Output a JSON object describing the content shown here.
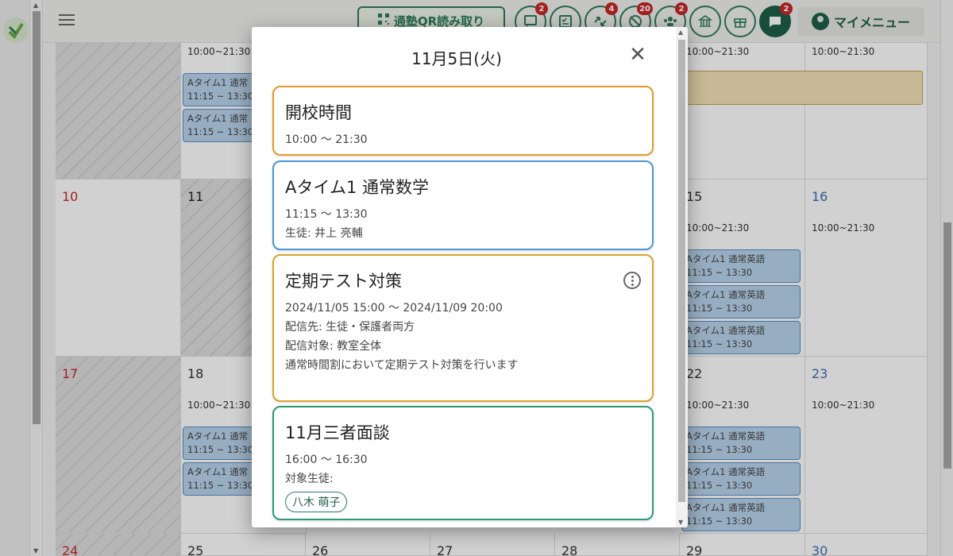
{
  "header": {
    "qr_button_label": "通塾QR読み取り",
    "icons": [
      {
        "name": "message-icon",
        "badge": "2"
      },
      {
        "name": "checklist-icon",
        "badge": ""
      },
      {
        "name": "exchange-icon",
        "badge": "4"
      },
      {
        "name": "blocked-icon",
        "badge": "20"
      },
      {
        "name": "group-icon",
        "badge": "2"
      },
      {
        "name": "school-icon",
        "badge": ""
      },
      {
        "name": "gift-icon",
        "badge": ""
      },
      {
        "name": "chat-icon",
        "badge": "2"
      }
    ],
    "my_menu_label": "マイメニュー"
  },
  "calendar": {
    "hours": "10:00~21:30",
    "event_line1": "Aタイム1 通常",
    "event_line2": "11:15 ~ 13:30",
    "event_english_line1": "Aタイム1 通常英語",
    "rows": [
      {
        "days": [
          "",
          "",
          "",
          "",
          "",
          "",
          ""
        ]
      },
      {
        "days": [
          "10",
          "11",
          "",
          "",
          "",
          "15",
          "16"
        ]
      },
      {
        "days": [
          "17",
          "18",
          "",
          "",
          "",
          "22",
          "23"
        ]
      },
      {
        "days": [
          "24",
          "25",
          "26",
          "27",
          "28",
          "29",
          "30"
        ]
      }
    ]
  },
  "modal": {
    "title": "11月5日(火)",
    "cards": [
      {
        "title": "開校時間",
        "lines": [
          "10:00 ～ 21:30"
        ]
      },
      {
        "title": "Aタイム1 通常数学",
        "lines": [
          "11:15 ～ 13:30",
          "生徒: 井上 亮輔"
        ]
      },
      {
        "title": "定期テスト対策",
        "lines": [
          "2024/11/05 15:00 ～ 2024/11/09 20:00",
          "配信先: 生徒・保護者両方",
          "配信対象: 教室全体",
          "通常時間割において定期テスト対策を行います"
        ]
      },
      {
        "title": "11月三者面談",
        "lines": [
          "16:00 ～ 16:30",
          "対象生徒:"
        ],
        "chip": "八木 萌子"
      }
    ]
  }
}
